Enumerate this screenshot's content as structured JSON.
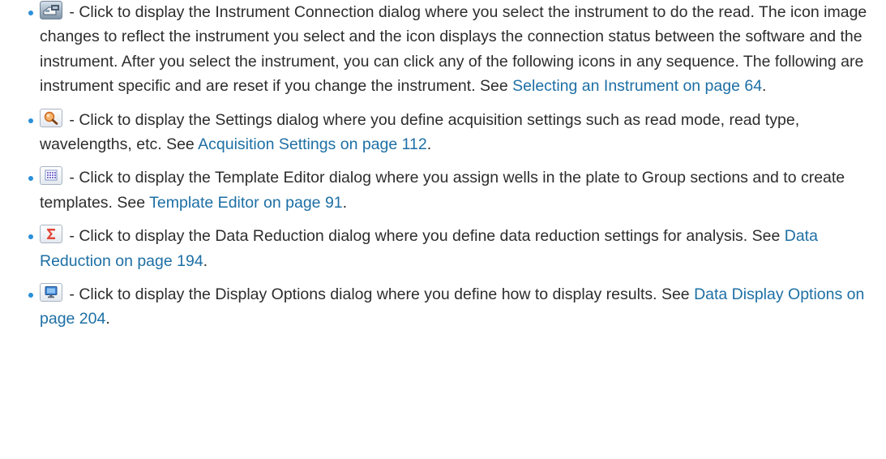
{
  "items": [
    {
      "icon": "instrument-connection-icon",
      "text": " - Click to display the Instrument Connection dialog where you select the instrument to do the read. The icon image changes to reflect the instrument you select and the icon displays the connection status between the software and the instrument. After you select the instrument, you can click any of the following icons in any sequence. The following are instrument specific and are reset if you change the instrument. See ",
      "link": "Selecting an Instrument on page 64",
      "after": "."
    },
    {
      "icon": "settings-magnifier-icon",
      "text": " - Click to display the Settings dialog where you define acquisition settings such as read mode, read type, wavelengths, etc. See ",
      "link": "Acquisition Settings on page 112",
      "after": "."
    },
    {
      "icon": "template-editor-icon",
      "text": " - Click to display the Template Editor dialog where you assign wells in the plate to Group sections and to create templates. See ",
      "link": "Template Editor on page 91",
      "after": "."
    },
    {
      "icon": "sigma-icon",
      "text": " - Click to display the Data Reduction dialog where you define data reduction settings for analysis. See ",
      "link": "Data Reduction on page 194",
      "after": "."
    },
    {
      "icon": "display-monitor-icon",
      "text": " - Click to display the Display Options dialog where you define how to display results. See ",
      "link": "Data Display Options on page 204",
      "after": "."
    }
  ],
  "colors": {
    "text": "#2d2d2d",
    "link": "#1d6fa5",
    "bullet": "#2a8fd8"
  }
}
